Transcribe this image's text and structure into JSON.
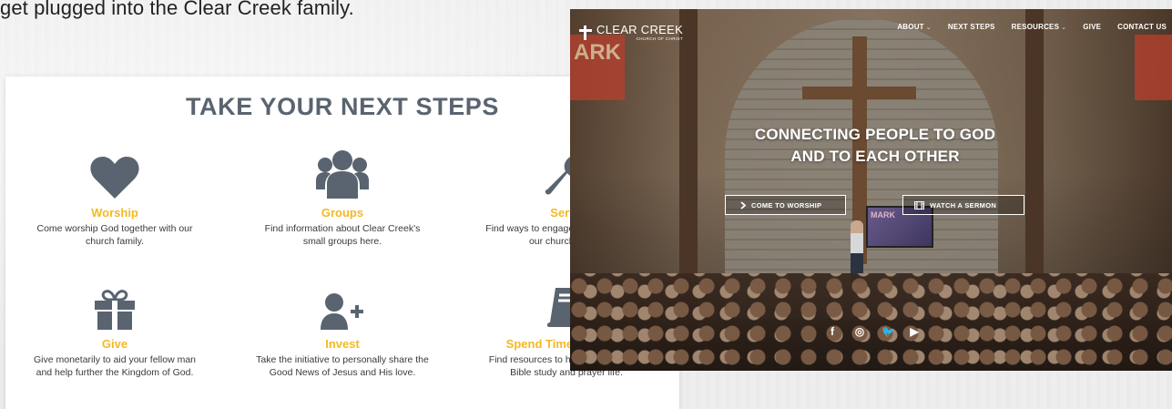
{
  "intro": {
    "text": "get plugged into the Clear Creek family."
  },
  "next_steps": {
    "title": "TAKE YOUR NEXT STEPS",
    "items": [
      {
        "icon": "heart-icon",
        "title": "Worship",
        "desc_line1": "Come worship God together with our",
        "desc_line2": "church family."
      },
      {
        "icon": "users-icon",
        "title": "Groups",
        "desc_line1": "Find information about Clear Creek's",
        "desc_line2": "small groups here."
      },
      {
        "icon": "wrench-icon",
        "title": "Serve",
        "desc_line1": "Find ways to engage in ministry inside",
        "desc_line2": "our church family."
      },
      {
        "icon": "gift-icon",
        "title": "Give",
        "desc_line1": "Give monetarily to aid your fellow man",
        "desc_line2": "and help further the Kingdom of God."
      },
      {
        "icon": "user-plus-icon",
        "title": "Invest",
        "desc_line1": "Take the initiative to personally share the",
        "desc_line2": "Good News of Jesus and His love."
      },
      {
        "icon": "book-icon",
        "title": "Spend Time with God",
        "desc_line1": "Find resources to help your personal",
        "desc_line2": "Bible study and prayer life."
      }
    ]
  },
  "hero": {
    "logo_name": "CLEAR CREEK",
    "logo_sub": "CHURCH OF CHRIST",
    "nav": [
      {
        "label": "ABOUT",
        "caret": "⌄"
      },
      {
        "label": "NEXT STEPS",
        "caret": ""
      },
      {
        "label": "RESOURCES",
        "caret": "⌄"
      },
      {
        "label": "GIVE",
        "caret": ""
      },
      {
        "label": "CONTACT US",
        "caret": ""
      }
    ],
    "headline_line1": "CONNECTING PEOPLE TO GOD",
    "headline_line2": "AND TO EACH OTHER",
    "btn_worship": "COME TO WORSHIP",
    "btn_sermon": "WATCH A SERMON",
    "sign_left": "ARK",
    "screen_text": "MARK",
    "socials": [
      {
        "icon": "facebook-icon",
        "glyph": "f"
      },
      {
        "icon": "instagram-icon",
        "glyph": "◎"
      },
      {
        "icon": "twitter-icon",
        "glyph": "🐦"
      },
      {
        "icon": "youtube-icon",
        "glyph": "▶"
      }
    ]
  },
  "colors": {
    "accent": "#f4b823",
    "icon_gray": "#5a6470",
    "title_gray": "#5a6470"
  }
}
